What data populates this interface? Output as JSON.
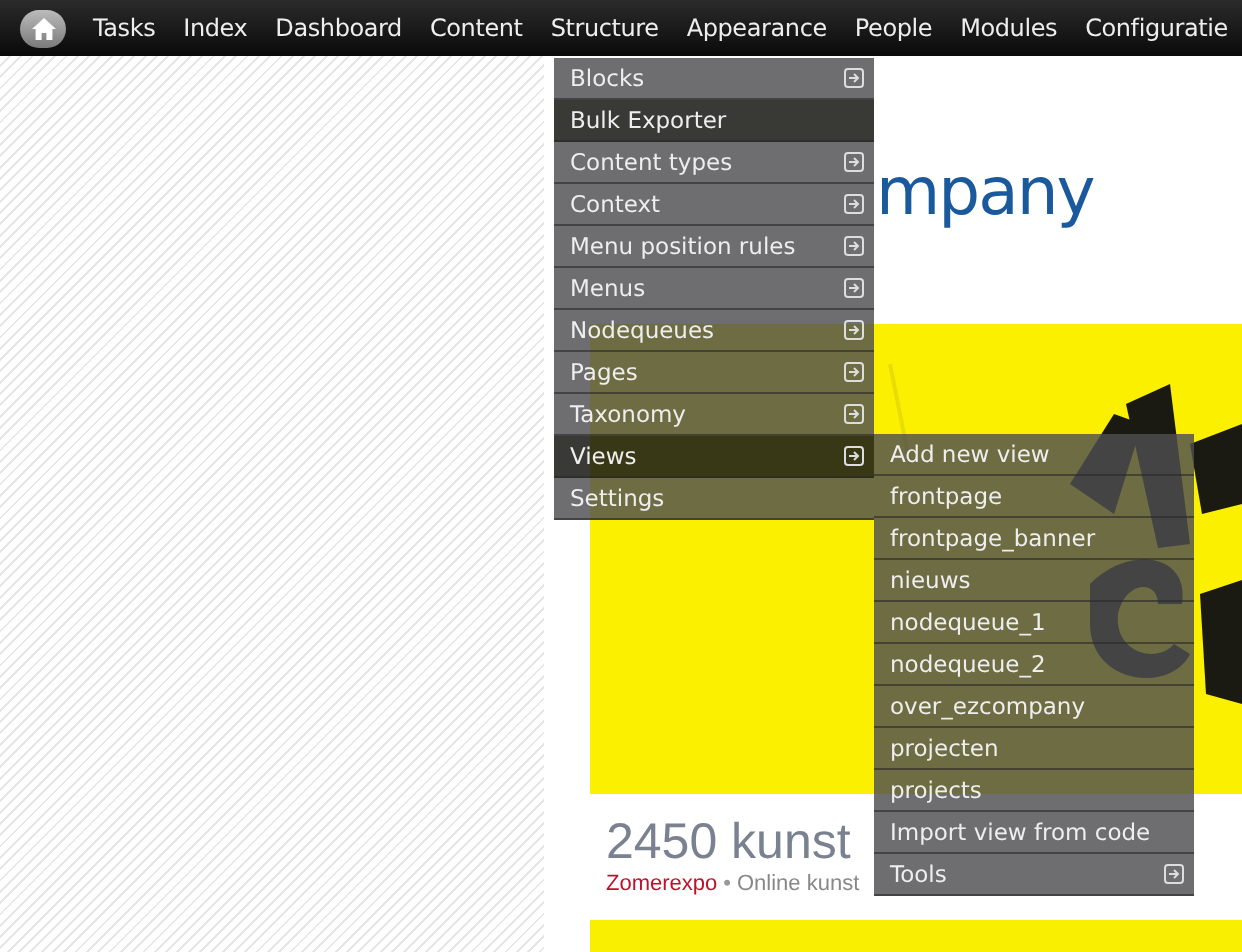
{
  "toolbar": {
    "items": [
      {
        "label": "Tasks"
      },
      {
        "label": "Index"
      },
      {
        "label": "Dashboard"
      },
      {
        "label": "Content"
      },
      {
        "label": "Structure"
      },
      {
        "label": "Appearance"
      },
      {
        "label": "People"
      },
      {
        "label": "Modules"
      },
      {
        "label": "Configuratie"
      }
    ]
  },
  "menu": {
    "items": [
      {
        "label": "Blocks",
        "has_submenu": true,
        "selected": false
      },
      {
        "label": "Bulk Exporter",
        "has_submenu": false,
        "selected": true
      },
      {
        "label": "Content types",
        "has_submenu": true,
        "selected": false
      },
      {
        "label": "Context",
        "has_submenu": true,
        "selected": false
      },
      {
        "label": "Menu position rules",
        "has_submenu": true,
        "selected": false
      },
      {
        "label": "Menus",
        "has_submenu": true,
        "selected": false
      },
      {
        "label": "Nodequeues",
        "has_submenu": true,
        "selected": false
      },
      {
        "label": "Pages",
        "has_submenu": true,
        "selected": false
      },
      {
        "label": "Taxonomy",
        "has_submenu": true,
        "selected": false
      },
      {
        "label": "Views",
        "has_submenu": true,
        "selected": true
      },
      {
        "label": "Settings",
        "has_submenu": false,
        "selected": false
      }
    ]
  },
  "submenu": {
    "items": [
      {
        "label": "Add new view",
        "has_submenu": false
      },
      {
        "label": "frontpage",
        "has_submenu": false
      },
      {
        "label": "frontpage_banner",
        "has_submenu": false
      },
      {
        "label": "nieuws",
        "has_submenu": false
      },
      {
        "label": "nodequeue_1",
        "has_submenu": false
      },
      {
        "label": "nodequeue_2",
        "has_submenu": false
      },
      {
        "label": "over_ezcompany",
        "has_submenu": false
      },
      {
        "label": "projecten",
        "has_submenu": false
      },
      {
        "label": "projects",
        "has_submenu": false
      },
      {
        "label": "Import view from code",
        "has_submenu": false
      },
      {
        "label": "Tools",
        "has_submenu": true
      }
    ]
  },
  "page": {
    "logo": "mpany",
    "headline": "2450 kunst",
    "tagline_link": "Zomerexpo",
    "separator": "•",
    "tagline": "Online kunst"
  }
}
